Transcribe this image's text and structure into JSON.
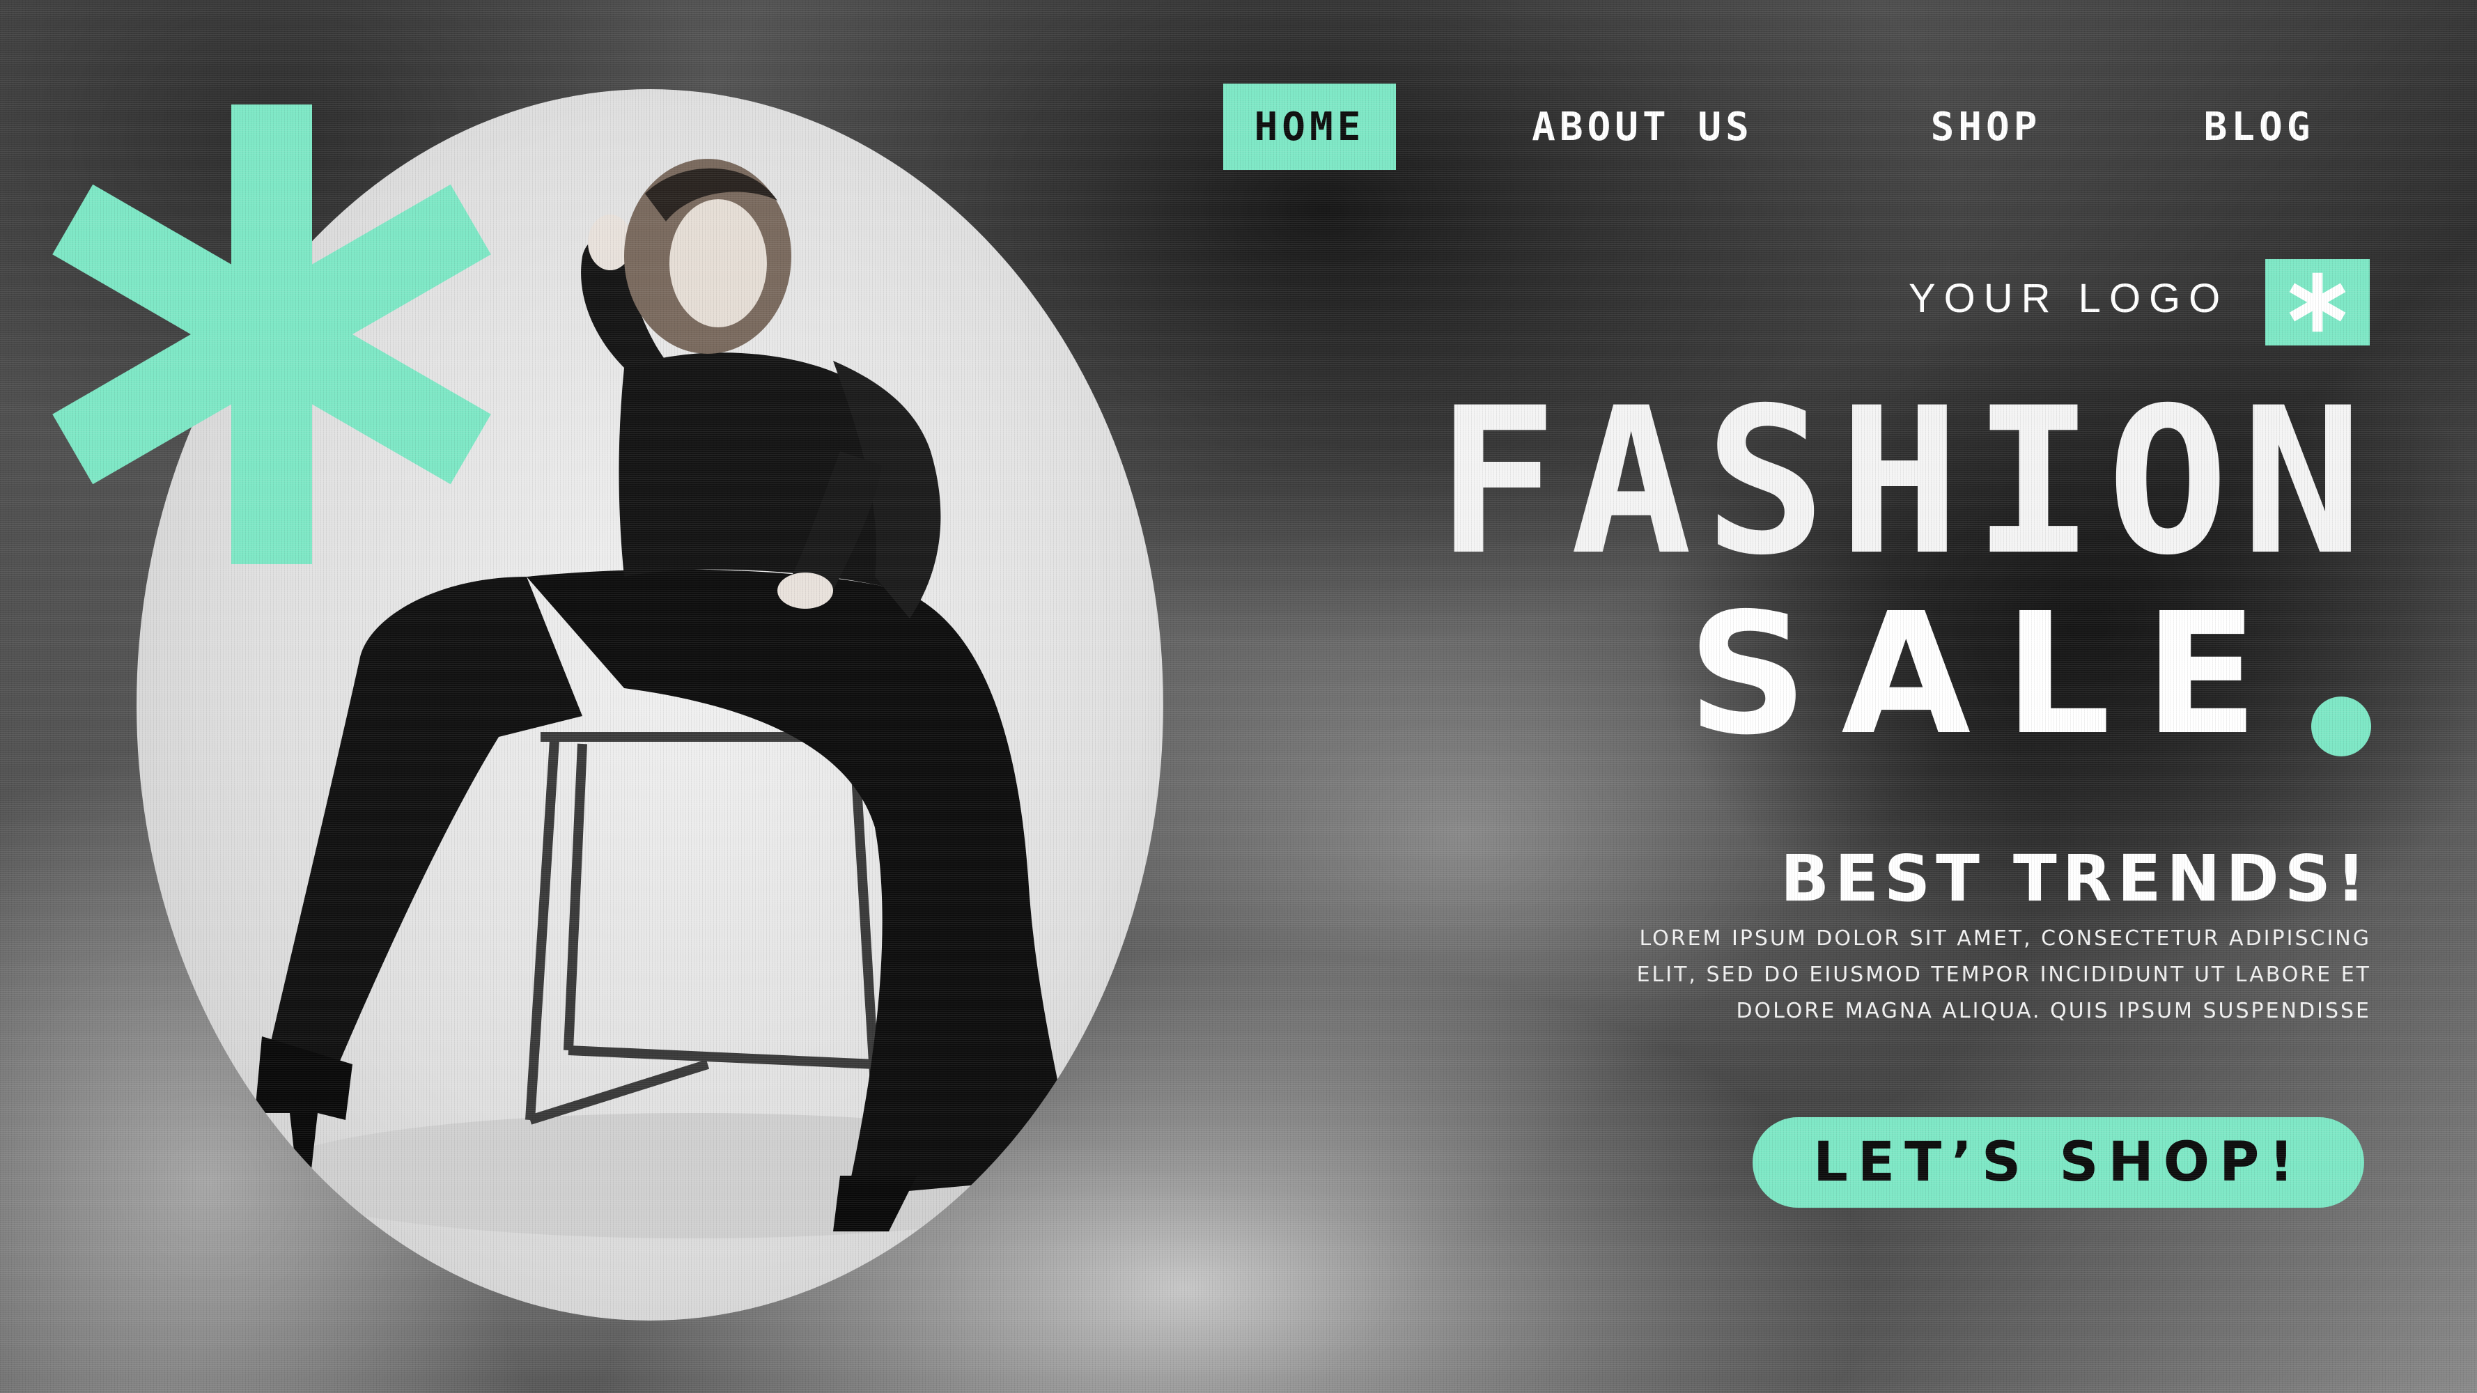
{
  "nav": {
    "items": [
      {
        "label": "HOME",
        "active": true
      },
      {
        "label": "ABOUT US",
        "active": false
      },
      {
        "label": "SHOP",
        "active": false
      },
      {
        "label": "BLOG",
        "active": false
      }
    ]
  },
  "brand": {
    "logo_text": "YOUR LOGO",
    "logo_icon": "asterisk-icon"
  },
  "hero": {
    "headline_line1": "FASHION",
    "headline_line2": "SALE",
    "subheading": "BEST TRENDS!",
    "body": "LOREM IPSUM DOLOR SIT AMET, CONSECTETUR ADIPISCING ELIT, SED DO EIUSMOD TEMPOR INCIDIDUNT UT LABORE ET DOLORE MAGNA ALIQUA. QUIS IPSUM SUSPENDISSE",
    "cta_label": "LET’S SHOP!"
  },
  "colors": {
    "accent": "#7ee8c6",
    "text": "#ffffff",
    "dark": "#0d0d0d"
  }
}
